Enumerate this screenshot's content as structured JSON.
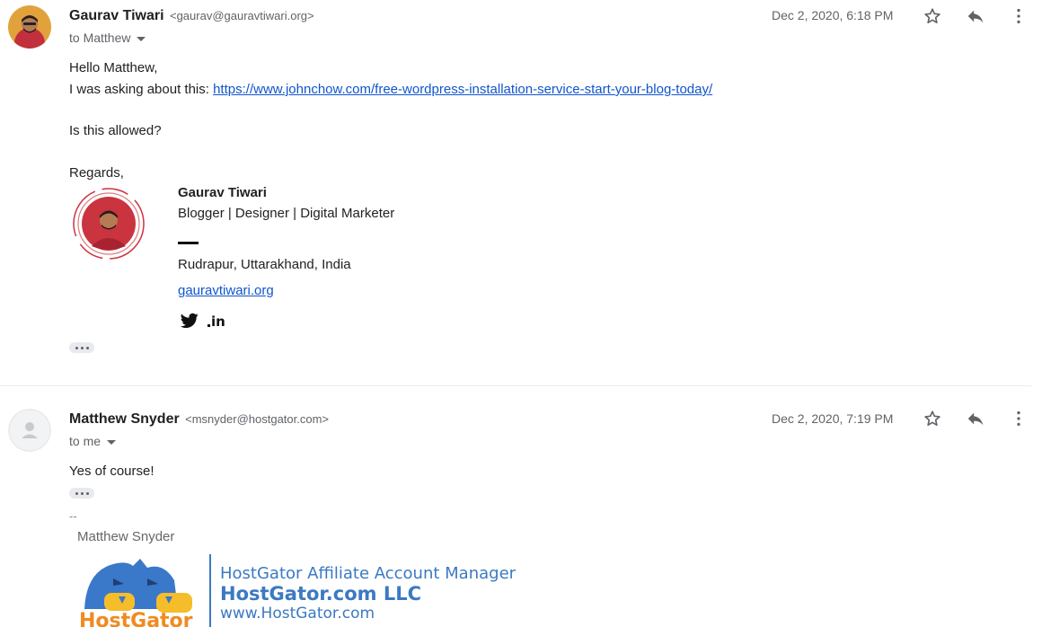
{
  "messages": [
    {
      "sender_name": "Gaurav Tiwari",
      "sender_email": "<gaurav@gauravtiwari.org>",
      "recipient": "to Matthew",
      "date": "Dec 2, 2020, 6:18 PM",
      "greeting": "Hello Matthew,",
      "line_prefix": "I was asking about this: ",
      "link_text": "https://www.johnchow.com/free-wordpress-installation-service-start-your-blog-today/",
      "question": "Is this allowed?",
      "closing": "Regards,",
      "signature": {
        "name": "Gaurav Tiwari",
        "title": "Blogger | Designer | Digital Marketer",
        "location": "Rudrapur, Uttarakhand, India",
        "website": "gauravtiwari.org",
        "social_icons": [
          "twitter-icon",
          "linkedin-icon"
        ],
        "linkedin_text": "in"
      }
    },
    {
      "sender_name": "Matthew Snyder",
      "sender_email": "<msnyder@hostgator.com>",
      "recipient": "to me",
      "date": "Dec 2, 2020, 7:19 PM",
      "body": "Yes of course!",
      "sig_separator": "--",
      "sig_name": "Matthew Snyder",
      "company": {
        "role": "HostGator Affiliate Account Manager",
        "name": "HostGator.com LLC",
        "url": "www.HostGator.com",
        "logo_text": "HostGator"
      }
    }
  ],
  "colors": {
    "link": "#1155cc",
    "meta_text": "#5f6368",
    "hostgator_blue": "#3b79c2",
    "avatar_ring": "#c9343f"
  }
}
